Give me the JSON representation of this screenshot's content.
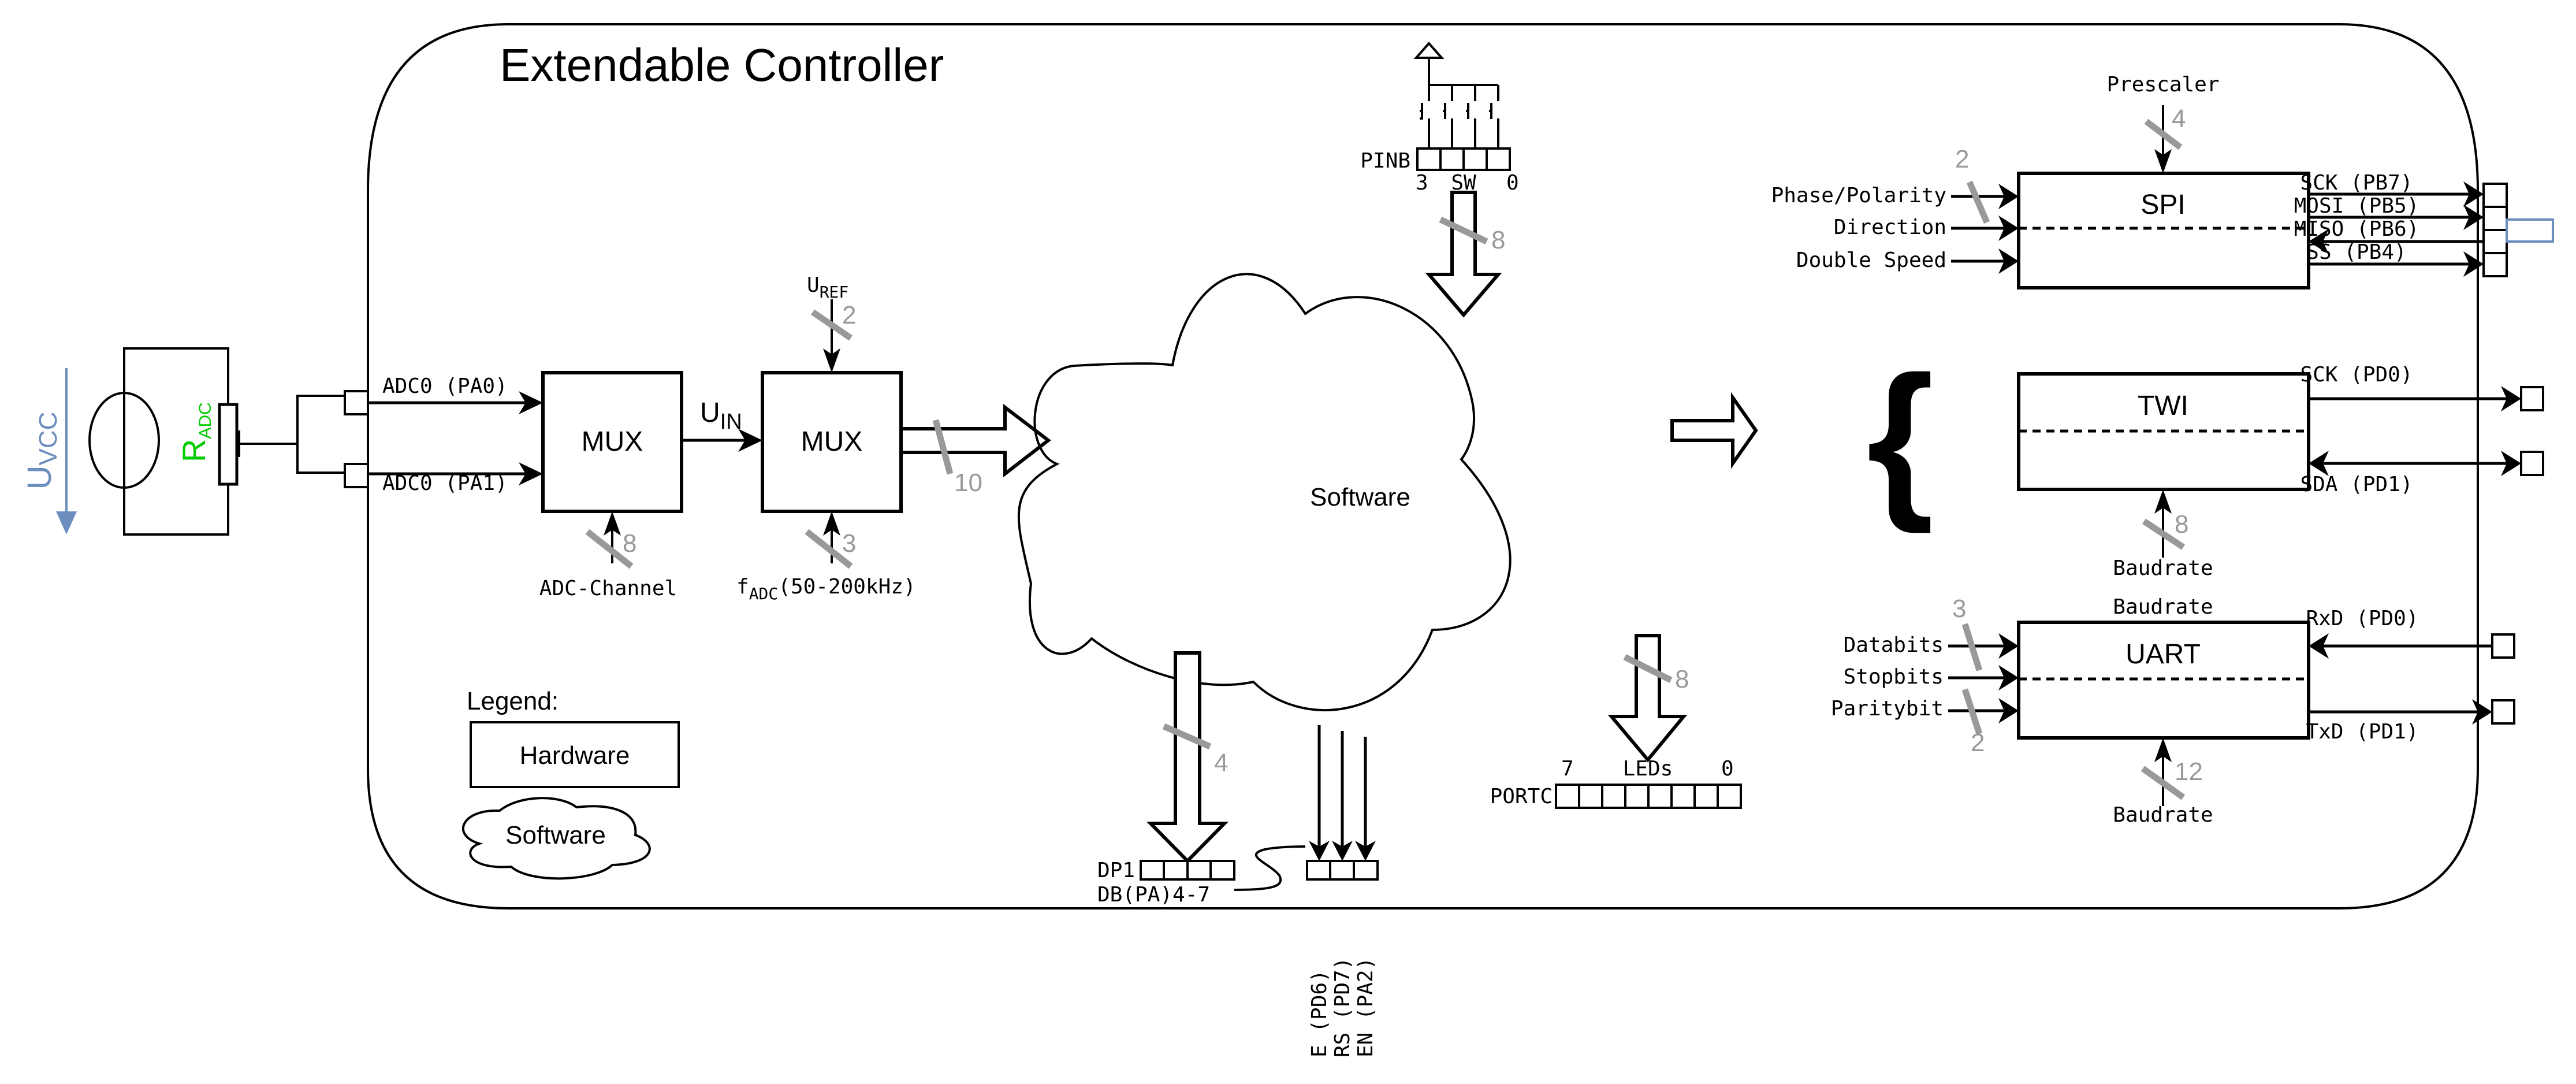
{
  "title": "Extendable Controller",
  "colors": {
    "line": "#000000",
    "bus_marker": "#999999",
    "voltage_arrow": "#6c8ebf",
    "resistor_label": "#00cc00"
  },
  "source": {
    "voltage_label": "U",
    "voltage_sub": "VCC",
    "resistor_label": "R",
    "resistor_sub": "ADC"
  },
  "adc": {
    "input_top": "ADC0 (PA0)",
    "input_bottom": "ADC0 (PA1)",
    "mux1_label": "MUX",
    "mux2_label": "MUX",
    "uin_label": "U",
    "uin_sub": "IN",
    "uref_label": "U",
    "uref_sub": "REF",
    "uref_bits": "2",
    "channel_label": "ADC-Channel",
    "channel_bits": "8",
    "fadc_label": "f",
    "fadc_sub": "ADC",
    "fadc_range": "(50-200kHz)",
    "fadc_bits": "3",
    "output_bits": "10"
  },
  "cloud": {
    "label": "Software"
  },
  "pinb": {
    "label": "PINB",
    "left_index": "3",
    "center_label": "SW",
    "right_index": "0",
    "bits": "8"
  },
  "spi": {
    "label": "SPI",
    "prescaler_label": "Prescaler",
    "prescaler_bits": "4",
    "inputs": [
      "Phase/Polarity",
      "Direction",
      "Double Speed"
    ],
    "input_bits": "2",
    "outputs": [
      "SCK (PB7)",
      "MOSI (PB5)",
      "MISO (PB6)",
      "SS (PB4)"
    ]
  },
  "twi": {
    "label": "TWI",
    "outputs": [
      "SCK (PD0)",
      "SDA (PD1)"
    ],
    "baudrate_label": "Baudrate",
    "baudrate_bits": "8"
  },
  "uart": {
    "label": "UART",
    "top_label": "Baudrate",
    "inputs": [
      "Databits",
      "Stopbits",
      "Paritybit"
    ],
    "databits_bits": "3",
    "paritybit_bits": "2",
    "outputs": [
      "RxD (PD0)",
      "TxD (PD1)"
    ],
    "baudrate_label": "Baudrate",
    "baudrate_bits": "12"
  },
  "display": {
    "dp_label": "DP1",
    "db_label": "DB(PA)4-7",
    "dp_bits": "4",
    "control_pins": [
      "E (PD6)",
      "RS (PD7)",
      "EN (PA2)"
    ]
  },
  "leds": {
    "port_label": "PORTC",
    "left_index": "7",
    "center_label": "LEDs",
    "right_index": "0",
    "bits": "8"
  },
  "legend": {
    "title": "Legend:",
    "hardware": "Hardware",
    "software": "Software"
  }
}
